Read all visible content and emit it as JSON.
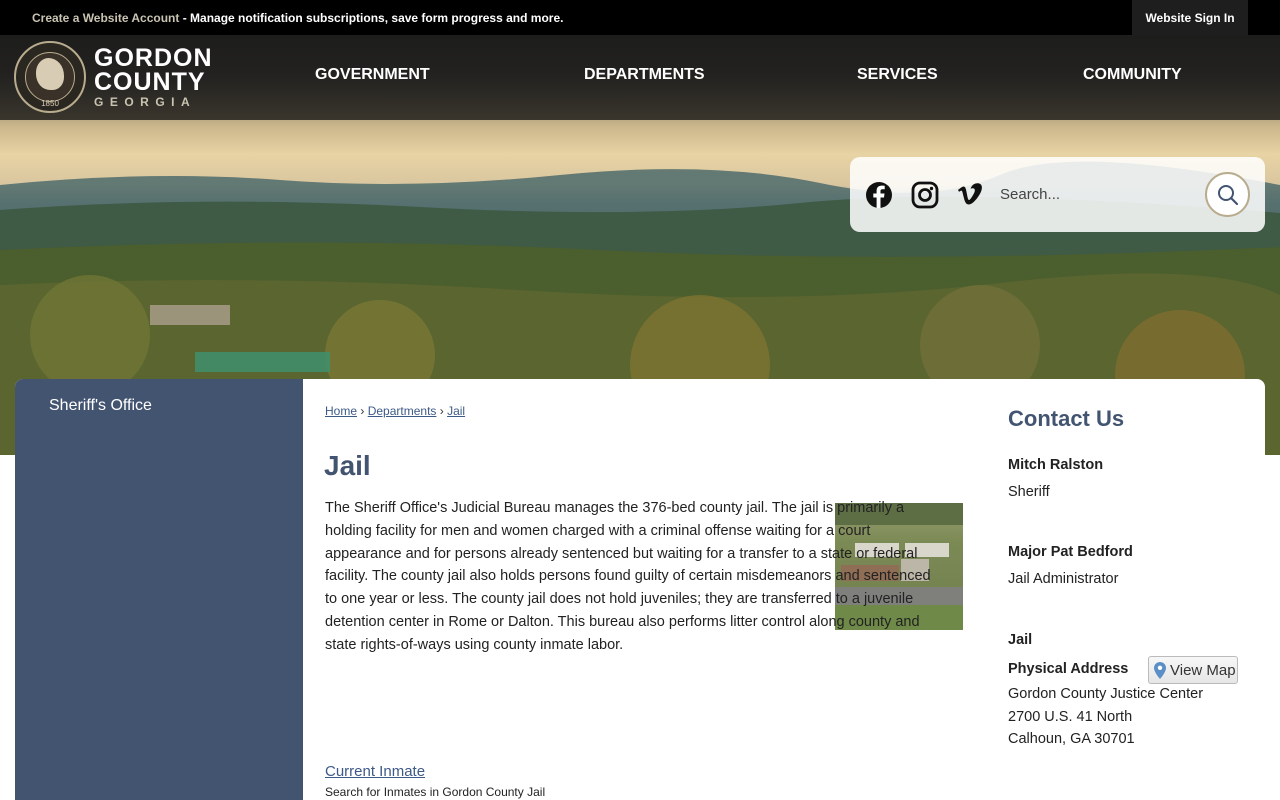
{
  "topbar": {
    "create_account_link": "Create a Website Account",
    "notice_text": " - Manage notification subscriptions, save form progress and more.",
    "signin_label": "Website Sign In"
  },
  "brand": {
    "line1": "GORDON",
    "line2": "COUNTY",
    "line3": "GEORGIA",
    "seal_year": "1850"
  },
  "nav": {
    "items": [
      {
        "label": "GOVERNMENT"
      },
      {
        "label": "DEPARTMENTS"
      },
      {
        "label": "SERVICES"
      },
      {
        "label": "COMMUNITY"
      }
    ]
  },
  "social": {
    "icons": [
      "facebook-icon",
      "instagram-icon",
      "vimeo-icon"
    ]
  },
  "search": {
    "placeholder": "Search..."
  },
  "sidebar": {
    "title": "Sheriff's Office"
  },
  "breadcrumb": {
    "items": [
      "Home",
      "Departments",
      "Jail"
    ],
    "separator": "›"
  },
  "page": {
    "title": "Jail",
    "paragraph": "The Sheriff Office's Judicial Bureau manages the 376-bed county jail. The jail is primarily a holding facility for men and women charged with a criminal offense waiting for a court appearance and for persons already sentenced but waiting for a transfer to a state or federal facility. The county jail also holds persons found guilty of certain misdemeanors and sentenced to one year or less. The county jail does not hold juveniles; they are transferred to a juvenile detention center in Rome or Dalton. This bureau also performs litter control along county and state rights-of-ways using county inmate labor.",
    "link_label": "Current Inmate",
    "link_description": "Search for Inmates in Gordon County Jail"
  },
  "contact": {
    "heading": "Contact Us",
    "people": [
      {
        "name": "Mitch Ralston",
        "role": "Sheriff"
      },
      {
        "name": "Major Pat Bedford",
        "role": "Jail Administrator"
      }
    ],
    "location_name": "Jail",
    "address_label": "Physical Address",
    "map_button": "View Map",
    "address_lines": [
      "Gordon County Justice Center",
      "2700 U.S. 41 North",
      "Calhoun, GA 30701"
    ]
  },
  "colors": {
    "sidebar": "#435471",
    "heading": "#435471",
    "link": "#3d5a86",
    "topbar": "#000000",
    "accent": "#b9ac8e"
  }
}
